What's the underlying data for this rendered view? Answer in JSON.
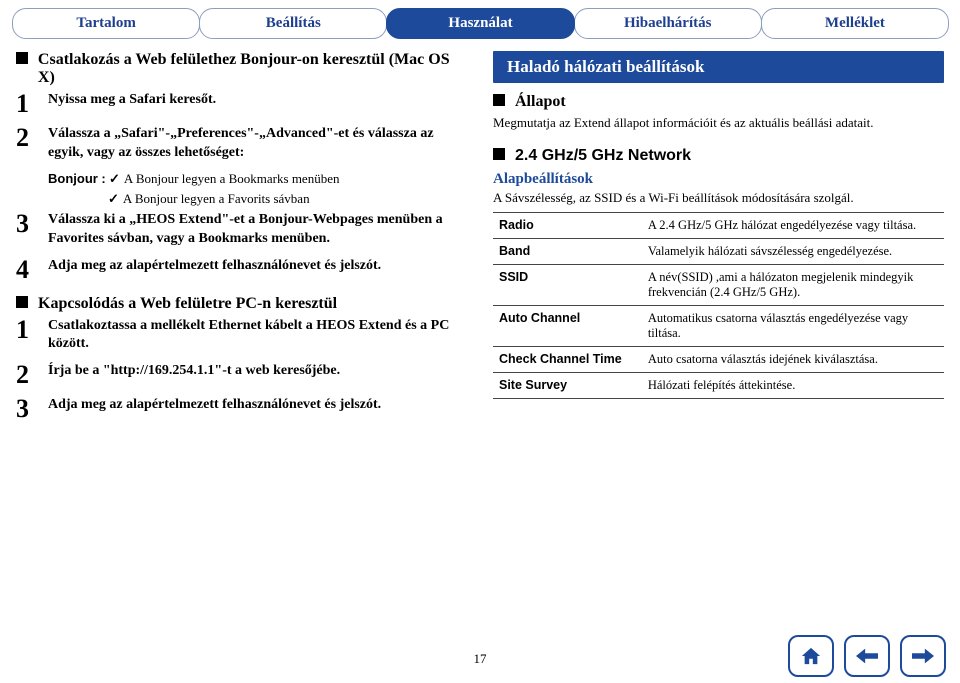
{
  "tabs": {
    "t0": "Tartalom",
    "t1": "Beállítás",
    "t2": "Használat",
    "t3": "Hibaelhárítás",
    "t4": "Melléklet"
  },
  "left": {
    "h1": "Csatlakozás a Web felülethez Bonjour-on keresztül (Mac OS X)",
    "s1": "Nyissa meg a Safari keresőt.",
    "s2": "Válassza a „Safari\"-„Preferences\"-„Advanced\"-et és válassza az egyik, vagy az összes lehetőséget:",
    "bonjour_label": "Bonjour :",
    "bonjour_a": "A Bonjour legyen a Bookmarks menüben",
    "bonjour_b": "A Bonjour legyen a Favorits sávban",
    "s3": "Válassza ki a „HEOS Extend\"-et a Bonjour-Webpages menüben a Favorites sávban, vagy a Bookmarks menüben.",
    "s4": "Adja meg az alapértelmezett felhasználónevet és jelszót.",
    "h2": "Kapcsolódás a Web felületre PC-n keresztül",
    "pc1": "Csatlakoztassa a mellékelt Ethernet kábelt a HEOS Extend és a PC között.",
    "pc2": "Írja be a \"http://169.254.1.1\"-t a web keresőjébe.",
    "pc3": "Adja meg az alapértelmezett felhasználónevet és jelszót."
  },
  "right": {
    "section": "Haladó hálózati beállítások",
    "status_h": "Állapot",
    "status_d": "Megmutatja az Extend állapot információit és az aktuális beállási adatait.",
    "net_h": "2.4 GHz/5 GHz Network",
    "net_sub": "Alapbeállítások",
    "net_desc": "A Sávszélesség, az SSID és a Wi-Fi beállítások módosítására szolgál."
  },
  "table": [
    {
      "k": "Radio",
      "v": "A 2.4 GHz/5 GHz hálózat engedélyezése vagy tiltása."
    },
    {
      "k": "Band",
      "v": "Valamelyik hálózati sávszélesség engedélyezése."
    },
    {
      "k": "SSID",
      "v": "A név(SSID) ,ami a hálózaton megjelenik mindegyik frekvencián (2.4 GHz/5 GHz)."
    },
    {
      "k": "Auto Channel",
      "v": "Automatikus csatorna választás engedélyezése vagy tiltása."
    },
    {
      "k": "Check Channel Time",
      "v": "Auto csatorna választás idejének kiválasztása."
    },
    {
      "k": "Site Survey",
      "v": "Hálózati felépítés áttekintése."
    }
  ],
  "page": "17"
}
